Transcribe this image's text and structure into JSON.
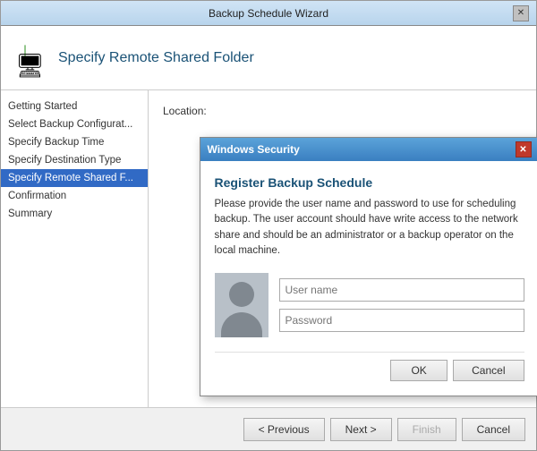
{
  "window": {
    "title": "Backup Schedule Wizard",
    "close_label": "✕"
  },
  "header": {
    "title": "Specify Remote Shared Folder",
    "icon_arrow": "↓",
    "icon_computer": "🖥"
  },
  "sidebar": {
    "items": [
      {
        "id": "getting-started",
        "label": "Getting Started",
        "active": false
      },
      {
        "id": "select-backup-config",
        "label": "Select Backup Configurat...",
        "active": false
      },
      {
        "id": "specify-backup-time",
        "label": "Specify Backup Time",
        "active": false
      },
      {
        "id": "specify-destination-type",
        "label": "Specify Destination Type",
        "active": false
      },
      {
        "id": "specify-remote-shared",
        "label": "Specify Remote Shared F...",
        "active": true
      },
      {
        "id": "confirmation",
        "label": "Confirmation",
        "active": false
      },
      {
        "id": "summary",
        "label": "Summary",
        "active": false
      }
    ]
  },
  "main": {
    "location_label": "Location:"
  },
  "dialog": {
    "title": "Windows Security",
    "heading": "Register Backup Schedule",
    "description": "Please provide the user name and password to use for scheduling backup. The user account should have write access to the network share and should be an administrator or a backup operator on the local machine.",
    "username_placeholder": "User name",
    "password_placeholder": "Password",
    "ok_label": "OK",
    "cancel_label": "Cancel",
    "close_label": "✕"
  },
  "footer": {
    "previous_label": "< Previous",
    "next_label": "Next >",
    "finish_label": "Finish",
    "cancel_label": "Cancel"
  }
}
